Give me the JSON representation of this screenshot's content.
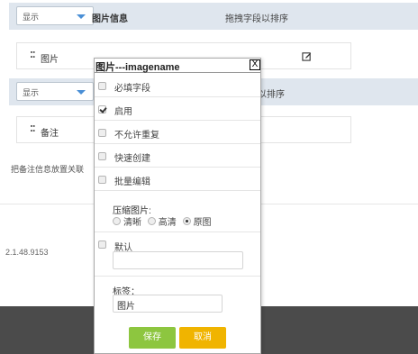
{
  "bar1": {
    "select_value": "显示",
    "title": "图片信息",
    "hint": "拖拽字段以排序"
  },
  "field_image": {
    "label": "图片"
  },
  "bar2": {
    "select_value": "显示",
    "title": "",
    "hint": "以排序"
  },
  "field_remark": {
    "label": "备注"
  },
  "note_text": "把备注信息放置关联",
  "version": "2.1.48.9153",
  "dialog": {
    "title": "图片---imagename",
    "close_label": "X",
    "options": [
      {
        "label": "必填字段",
        "checked": false
      },
      {
        "label": "启用",
        "checked": true
      },
      {
        "label": "不允许重复",
        "checked": false
      },
      {
        "label": "快速创建",
        "checked": false
      },
      {
        "label": "批量编辑",
        "checked": false
      }
    ],
    "compress_label": "压缩图片:",
    "compress_options": [
      {
        "label": "清晰",
        "selected": false
      },
      {
        "label": "高清",
        "selected": false
      },
      {
        "label": "原图",
        "selected": true
      }
    ],
    "default_label": "默认",
    "default_value": "",
    "tag_label": "标签：",
    "tag_value": "图片",
    "save_label": "保存",
    "cancel_label": "取消"
  },
  "colors": {
    "save": "#8dc63f",
    "cancel": "#f0b400",
    "bar": "#dfe6ee",
    "footer": "#4b4b4b"
  }
}
